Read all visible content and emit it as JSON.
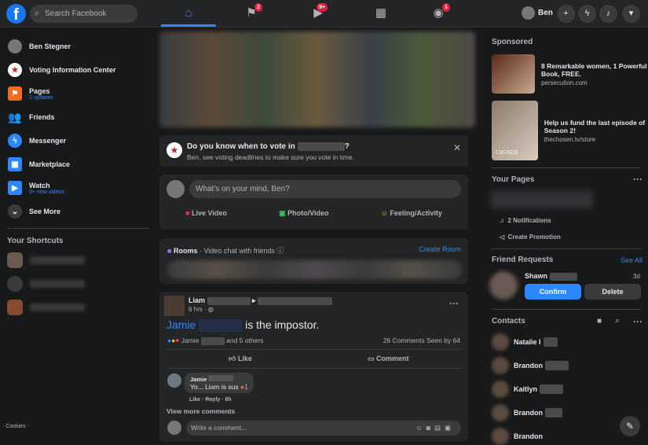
{
  "header": {
    "search_placeholder": "Search Facebook",
    "badges": {
      "pages": "2",
      "watch": "9+",
      "groups": "1"
    },
    "profile_name": "Ben"
  },
  "sidebar": {
    "items": [
      {
        "label": "Ben Stegner"
      },
      {
        "label": "Voting Information Center"
      },
      {
        "label": "Pages",
        "sub": "2 updates"
      },
      {
        "label": "Friends"
      },
      {
        "label": "Messenger"
      },
      {
        "label": "Marketplace"
      },
      {
        "label": "Watch",
        "sub": "9+ new videos"
      },
      {
        "label": "See More"
      }
    ],
    "shortcuts_title": "Your Shortcuts",
    "footer": "· Cookies ·"
  },
  "vote": {
    "title": "Do you know when to vote in",
    "title_end": "?",
    "sub": "Ben, see voting deadlines to make sure you vote in time."
  },
  "composer": {
    "placeholder": "What's on your mind, Ben?",
    "live": "Live Video",
    "photo": "Photo/Video",
    "feeling": "Feeling/Activity"
  },
  "rooms": {
    "title": "Rooms",
    "sub": " · Video chat with friends",
    "create": "Create Room"
  },
  "post": {
    "author": "Liam",
    "time": "6 hrs ·",
    "tag_name": "Jamie",
    "text": "is the impostor.",
    "reactors": "Jamie",
    "others": "and 5 others",
    "comments": "26 Comments",
    "seen": "Seen by 64",
    "like": "Like",
    "comment": "Comment",
    "reply": {
      "author": "Jamie",
      "text": "Yo... Liam is sus",
      "reactions": "1",
      "actions": "Like · Reply · 6h"
    },
    "view_more": "View more comments",
    "write_placeholder": "Write a comment..."
  },
  "right": {
    "sponsored": "Sponsored",
    "ads": [
      {
        "title": "8 Remarkable women, 1 Powerful Book, FREE.",
        "url": "persecution.com"
      },
      {
        "title": "Help us fund the last episode of Season 2!",
        "url": "thechosen.tv/store",
        "logo": "CHOSEN"
      }
    ],
    "pages_title": "Your Pages",
    "notifications": "2 Notifications",
    "promotion": "Create Promotion",
    "fr_title": "Friend Requests",
    "see_all": "See All",
    "fr_name": "Shawn",
    "fr_time": "3d",
    "confirm": "Confirm",
    "delete": "Delete",
    "contacts_title": "Contacts",
    "contacts": [
      "Natalie I",
      "Brandon",
      "Kaitlyn",
      "Brandon",
      "Brandon"
    ]
  },
  "colors": {
    "accent": "#2d88ff",
    "badge": "#e41e3f",
    "bg": "#18191a",
    "card": "#242526"
  }
}
